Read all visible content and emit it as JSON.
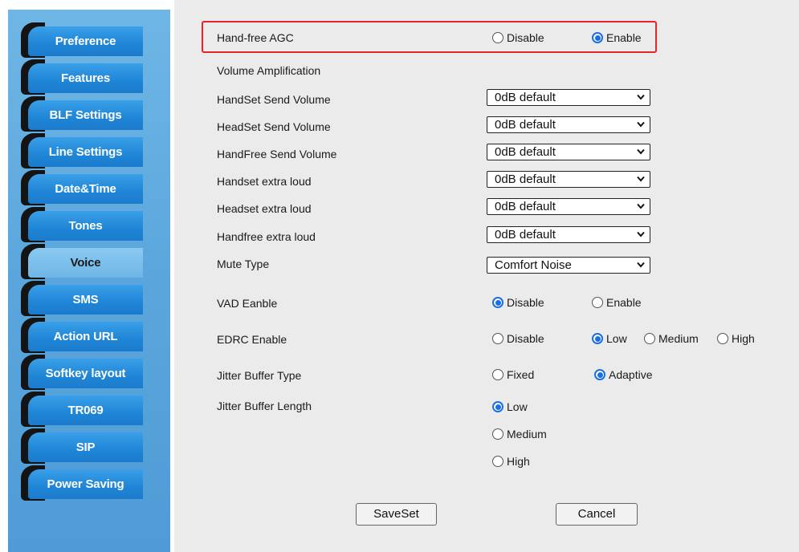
{
  "sidebar": {
    "items": [
      {
        "label": "Preference",
        "active": false
      },
      {
        "label": "Features",
        "active": false
      },
      {
        "label": "BLF Settings",
        "active": false
      },
      {
        "label": "Line Settings",
        "active": false
      },
      {
        "label": "Date&Time",
        "active": false
      },
      {
        "label": "Tones",
        "active": false
      },
      {
        "label": "Voice",
        "active": true
      },
      {
        "label": "SMS",
        "active": false
      },
      {
        "label": "Action URL",
        "active": false
      },
      {
        "label": "Softkey layout",
        "active": false
      },
      {
        "label": "TR069",
        "active": false
      },
      {
        "label": "SIP",
        "active": false
      },
      {
        "label": "Power Saving",
        "active": false
      }
    ]
  },
  "form": {
    "agc": {
      "label": "Hand-free AGC",
      "opt_disable": "Disable",
      "opt_enable": "Enable",
      "selected": "Enable"
    },
    "volume_amplification": "Volume Amplification",
    "selects": [
      {
        "label": "HandSet Send Volume",
        "value": "0dB default"
      },
      {
        "label": "HeadSet Send Volume",
        "value": "0dB default"
      },
      {
        "label": "HandFree Send Volume",
        "value": "0dB default"
      },
      {
        "label": "Handset extra loud",
        "value": "0dB default"
      },
      {
        "label": "Headset extra loud",
        "value": "0dB default"
      },
      {
        "label": "Handfree extra loud",
        "value": "0dB default"
      },
      {
        "label": "Mute Type",
        "value": "Comfort Noise"
      }
    ],
    "vad": {
      "label": "VAD Eanble",
      "opt_disable": "Disable",
      "opt_enable": "Enable",
      "selected": "Disable"
    },
    "edrc": {
      "label": "EDRC Enable",
      "opt_disable": "Disable",
      "opt_low": "Low",
      "opt_medium": "Medium",
      "opt_high": "High",
      "selected": "Low"
    },
    "jitter_type": {
      "label": "Jitter Buffer Type",
      "opt_fixed": "Fixed",
      "opt_adaptive": "Adaptive",
      "selected": "Adaptive"
    },
    "jitter_length": {
      "label": "Jitter Buffer Length",
      "opt_low": "Low",
      "opt_medium": "Medium",
      "opt_high": "High",
      "selected": "Low"
    }
  },
  "buttons": {
    "save": "SaveSet",
    "cancel": "Cancel"
  },
  "colors": {
    "highlight_border": "#e8232a",
    "radio_accent": "#1a6fe0",
    "sidebar_bg": "#5aa6dc"
  }
}
